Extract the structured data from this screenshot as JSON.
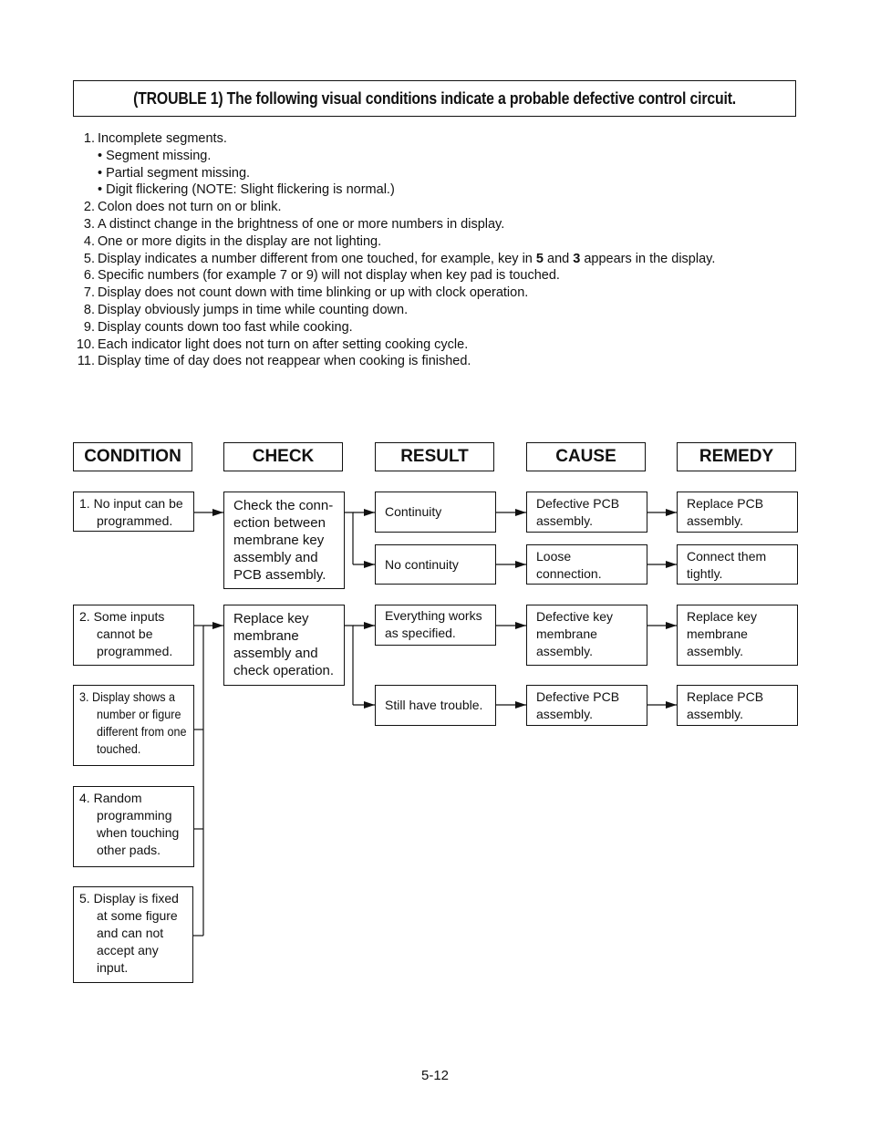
{
  "title": "(TROUBLE 1) The following visual conditions indicate a probable defective control circuit.",
  "conditions_list": [
    {
      "num": "1.",
      "text": "Incomplete segments.",
      "subitems": [
        "• Segment missing.",
        "• Partial segment missing.",
        "• Digit flickering (NOTE: Slight flickering is normal.)"
      ]
    },
    {
      "num": "2.",
      "text": "Colon does not turn on or blink."
    },
    {
      "num": "3.",
      "text": "A distinct change in the brightness of one or more numbers in display."
    },
    {
      "num": "4.",
      "text": "One or more digits in the display are not lighting."
    },
    {
      "num": "5.",
      "text_before": "Display indicates a number different from one touched, for example, key in ",
      "bold1": "5",
      "text_mid": " and ",
      "bold2": "3",
      "text_after": " appears in the display."
    },
    {
      "num": "6.",
      "text": "Specific numbers (for example 7 or 9) will not display when key pad is touched."
    },
    {
      "num": "7.",
      "text": "Display does not count down with time blinking or up with clock operation."
    },
    {
      "num": "8.",
      "text": "Display obviously jumps in time while counting down."
    },
    {
      "num": "9.",
      "text": "Display counts down too fast while cooking."
    },
    {
      "num": "10.",
      "text": "Each indicator light does not turn on after setting cooking cycle."
    },
    {
      "num": "11.",
      "text": "Display time of day does not reappear when cooking is finished."
    }
  ],
  "flowchart": {
    "headers": {
      "condition": "CONDITION",
      "check": "CHECK",
      "result": "RESULT",
      "cause": "CAUSE",
      "remedy": "REMEDY"
    },
    "conditions": [
      {
        "num": "1.",
        "lines": [
          "No input can be",
          "programmed."
        ]
      },
      {
        "num": "2.",
        "lines": [
          "Some inputs",
          "cannot be",
          "programmed."
        ]
      },
      {
        "num": "3.",
        "lines": [
          "Display shows a",
          "number or figure",
          "different from one",
          "touched."
        ]
      },
      {
        "num": "4.",
        "lines": [
          "Random",
          "programming",
          "when touching",
          "other pads."
        ]
      },
      {
        "num": "5.",
        "lines": [
          "Display is fixed",
          "at some figure",
          "and can not",
          "accept any",
          "input."
        ]
      }
    ],
    "checks": [
      {
        "lines": [
          "Check the conn-",
          "ection between",
          "membrane key",
          "assembly and",
          "PCB assembly."
        ]
      },
      {
        "lines": [
          "Replace key",
          "membrane",
          "assembly and",
          "check operation."
        ]
      }
    ],
    "results": [
      {
        "lines": [
          "Continuity"
        ]
      },
      {
        "lines": [
          "No continuity"
        ]
      },
      {
        "lines": [
          "Everything works",
          "as specified."
        ]
      },
      {
        "lines": [
          "Still have trouble."
        ]
      }
    ],
    "causes": [
      {
        "lines": [
          "Defective PCB",
          "assembly."
        ]
      },
      {
        "lines": [
          "Loose",
          "connection."
        ]
      },
      {
        "lines": [
          "Defective key",
          "membrane",
          "assembly."
        ]
      },
      {
        "lines": [
          "Defective PCB",
          "assembly."
        ]
      }
    ],
    "remedies": [
      {
        "lines": [
          "Replace PCB",
          "assembly."
        ]
      },
      {
        "lines": [
          "Connect them",
          "tightly."
        ]
      },
      {
        "lines": [
          "Replace key",
          "membrane",
          "assembly."
        ]
      },
      {
        "lines": [
          "Replace PCB",
          "assembly."
        ]
      }
    ]
  },
  "page_number": "5-12"
}
